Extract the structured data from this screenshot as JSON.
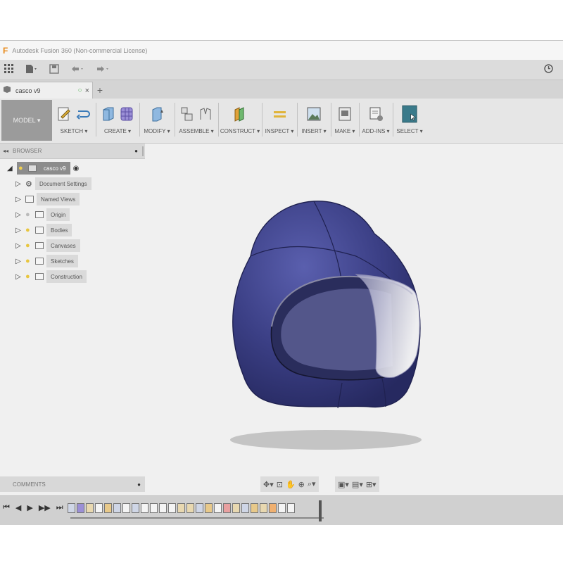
{
  "window": {
    "title": "Autodesk Fusion 360 (Non-commercial License)"
  },
  "quick_access": {
    "icons": [
      "grid-icon",
      "file-icon",
      "save-icon",
      "undo-icon",
      "redo-icon"
    ],
    "clock_icon": "clock-icon"
  },
  "document_tab": {
    "name": "casco v9",
    "close_label": "×",
    "new_tab_label": "+"
  },
  "ribbon": {
    "workspace": "MODEL ▾",
    "groups": [
      {
        "label": "SKETCH ▾"
      },
      {
        "label": "CREATE ▾"
      },
      {
        "label": "MODIFY ▾"
      },
      {
        "label": "ASSEMBLE ▾"
      },
      {
        "label": "CONSTRUCT ▾"
      },
      {
        "label": "INSPECT ▾"
      },
      {
        "label": "INSERT ▾"
      },
      {
        "label": "MAKE ▾"
      },
      {
        "label": "ADD-INS ▾"
      },
      {
        "label": "SELECT ▾"
      }
    ]
  },
  "browser": {
    "title": "BROWSER",
    "root": "casco v9",
    "items": [
      {
        "label": "Document Settings"
      },
      {
        "label": "Named Views"
      },
      {
        "label": "Origin"
      },
      {
        "label": "Bodies"
      },
      {
        "label": "Canvases"
      },
      {
        "label": "Sketches"
      },
      {
        "label": "Construction"
      }
    ]
  },
  "comments": {
    "title": "COMMENTS"
  },
  "colors": {
    "helmet": "#3b3f85",
    "accent": "#e88a1a",
    "select_button": "#3a7a8a"
  }
}
